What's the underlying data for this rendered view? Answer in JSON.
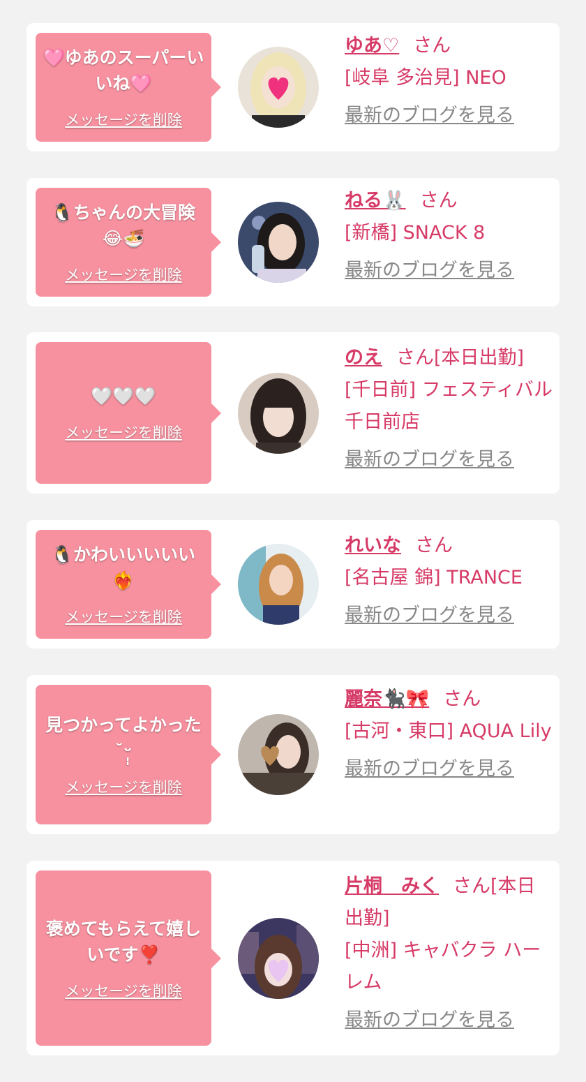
{
  "cards": [
    {
      "message": "🩷ゆあのスーパーいいね🩷",
      "delete_label": "メッセージを削除",
      "name": "ゆあ♡",
      "san": "さん",
      "status": "",
      "shop": "[岐阜 多治見] NEO",
      "blog_label": "最新のブログを見る",
      "avatar_icon": "photo-avatar-blonde-heart"
    },
    {
      "message": "🐧ちゃんの大冒険 😂🍜",
      "delete_label": "メッセージを削除",
      "name": "ねる🐰",
      "san": "さん",
      "status": "",
      "shop": "[新橋] SNACK 8",
      "blog_label": "最新のブログを見る",
      "avatar_icon": "photo-avatar-night"
    },
    {
      "message": "🤍🤍🤍",
      "delete_label": "メッセージを削除",
      "name": "のえ",
      "san": "さん",
      "status": "[本日出勤]",
      "shop": "[千日前] フェスティバル 千日前店",
      "blog_label": "最新のブログを見る",
      "avatar_icon": "photo-avatar-dark-hair"
    },
    {
      "message": "🐧かわいいいいい❤️‍🔥",
      "delete_label": "メッセージを削除",
      "name": "れいな",
      "san": "さん",
      "status": "",
      "shop": "[名古屋 錦] TRANCE",
      "blog_label": "最新のブログを見る",
      "avatar_icon": "photo-avatar-blonde"
    },
    {
      "message": "見つかってよかった ˘ᵕ̩̩",
      "delete_label": "メッセージを削除",
      "name": "麗奈🐈‍⬛🎀",
      "san": "さん",
      "status": "",
      "shop": "[古河・東口] AQUA Lily",
      "blog_label": "最新のブログを見る",
      "avatar_icon": "photo-avatar-heart-face"
    },
    {
      "message": "褒めてもらえて嬉しいです❣️",
      "delete_label": "メッセージを削除",
      "name": "片桐　みく",
      "san": "さん",
      "status": "[本日出勤]",
      "shop": "[中洲] キャバクラ ハーレム",
      "blog_label": "最新のブログを見る",
      "avatar_icon": "photo-avatar-city-heart"
    }
  ],
  "colors": {
    "background": "#f2f2f2",
    "bubble": "#f7919f",
    "accent": "#d63a66",
    "muted": "#888888"
  }
}
